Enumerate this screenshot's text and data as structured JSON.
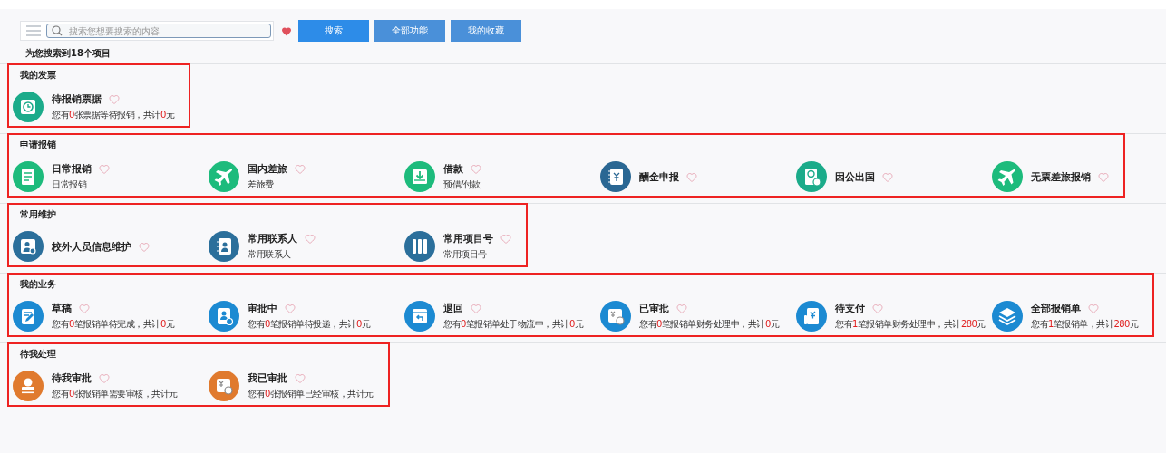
{
  "toolbar": {
    "search": {
      "placeholder": "搜索您想要搜索的内容"
    },
    "buttons": [
      {
        "label": "搜索",
        "primary": true
      },
      {
        "label": "全部功能",
        "primary": false
      },
      {
        "label": "我的收藏",
        "primary": false
      }
    ]
  },
  "result_count": "为您搜索到18个项目",
  "sections": [
    {
      "title": "我的发票",
      "outlined": true,
      "items": [
        {
          "title": "待报销票据",
          "kind": "receipt",
          "color": "#1bab8a",
          "favorited": false,
          "description": [
            {
              "text": "您有"
            },
            {
              "text": "0",
              "highlight": true
            },
            {
              "text": "张票据等待报销，共计"
            },
            {
              "text": "0",
              "highlight": true
            },
            {
              "text": "元"
            }
          ]
        }
      ]
    },
    {
      "title": "申请报销",
      "outlined": true,
      "items": [
        {
          "title": "日常报销",
          "kind": "document",
          "color": "#1dbb7c",
          "favorited": false,
          "description": [
            {
              "text": "日常报销"
            }
          ]
        },
        {
          "title": "国内差旅",
          "kind": "plane",
          "color": "#1dbb7c",
          "favorited": false,
          "description": [
            {
              "text": "差旅费"
            }
          ]
        },
        {
          "title": "借款",
          "kind": "inbox",
          "color": "#1dbb7c",
          "favorited": false,
          "description": [
            {
              "text": "预借/付款"
            }
          ]
        },
        {
          "title": "酬金申报",
          "kind": "yen-book",
          "color": "#2a6793",
          "favorited": false
        },
        {
          "title": "因公出国",
          "kind": "passport",
          "color": "#1bab8a",
          "favorited": false
        },
        {
          "title": "无票差旅报销",
          "kind": "plane",
          "color": "#1dbb7c",
          "favorited": false
        }
      ]
    },
    {
      "title": "常用维护",
      "outlined": true,
      "items": [
        {
          "title": "校外人员信息维护",
          "kind": "person-card",
          "color": "#2b6f9b",
          "favorited": false
        },
        {
          "title": "常用联系人",
          "kind": "contacts",
          "color": "#2b6f9b",
          "favorited": false,
          "description": [
            {
              "text": "常用联系人"
            }
          ]
        },
        {
          "title": "常用项目号",
          "kind": "binders",
          "color": "#2b6f9b",
          "favorited": false,
          "description": [
            {
              "text": "常用项目号"
            }
          ]
        }
      ]
    },
    {
      "title": "我的业务",
      "outlined": true,
      "items": [
        {
          "title": "草稿",
          "kind": "edit",
          "color": "#1c8ad2",
          "favorited": false,
          "description": [
            {
              "text": "您有"
            },
            {
              "text": "0",
              "highlight": true
            },
            {
              "text": "笔报销单待完成，共计"
            },
            {
              "text": "0",
              "highlight": true
            },
            {
              "text": "元"
            }
          ]
        },
        {
          "title": "审批中",
          "kind": "person-clock",
          "color": "#1c8ad2",
          "favorited": false,
          "description": [
            {
              "text": "您有"
            },
            {
              "text": "0",
              "highlight": true
            },
            {
              "text": "笔报销单待投递，共计"
            },
            {
              "text": "0",
              "highlight": true
            },
            {
              "text": "元"
            }
          ]
        },
        {
          "title": "退回",
          "kind": "window-return",
          "color": "#1c8ad2",
          "favorited": false,
          "description": [
            {
              "text": "您有"
            },
            {
              "text": "0",
              "highlight": true
            },
            {
              "text": "笔报销单处于物流中，共计"
            },
            {
              "text": "0",
              "highlight": true
            },
            {
              "text": "元"
            }
          ]
        },
        {
          "title": "已审批",
          "kind": "yen-clock",
          "color": "#1c8ad2",
          "favorited": false,
          "description": [
            {
              "text": "您有"
            },
            {
              "text": "0",
              "highlight": true
            },
            {
              "text": "笔报销单财务处理中，共计"
            },
            {
              "text": "0",
              "highlight": true
            },
            {
              "text": "元"
            }
          ]
        },
        {
          "title": "待支付",
          "kind": "yen-receipt",
          "color": "#1c8ad2",
          "favorited": false,
          "description": [
            {
              "text": "您有"
            },
            {
              "text": "1",
              "highlight": true
            },
            {
              "text": "笔报销单财务处理中，共计"
            },
            {
              "text": "280",
              "highlight": true
            },
            {
              "text": "元"
            }
          ]
        },
        {
          "title": "全部报销单",
          "kind": "layers",
          "color": "#1c8ad2",
          "favorited": false,
          "description": [
            {
              "text": "您有"
            },
            {
              "text": "1",
              "highlight": true
            },
            {
              "text": "笔报销单，共计"
            },
            {
              "text": "280",
              "highlight": true
            },
            {
              "text": "元"
            }
          ]
        }
      ]
    },
    {
      "title": "待我处理",
      "outlined": true,
      "items": [
        {
          "title": "待我审批",
          "kind": "stamp",
          "color": "#e07a2e",
          "favorited": false,
          "description": [
            {
              "text": "您有"
            },
            {
              "text": "0",
              "highlight": true
            },
            {
              "text": "张报销单需要审核，共计元"
            }
          ]
        },
        {
          "title": "我已审批",
          "kind": "yen-clock",
          "color": "#e07a2e",
          "favorited": false,
          "description": [
            {
              "text": "您有"
            },
            {
              "text": "0",
              "highlight": true
            },
            {
              "text": "张报销单已经审核，共计元"
            }
          ]
        }
      ]
    }
  ]
}
